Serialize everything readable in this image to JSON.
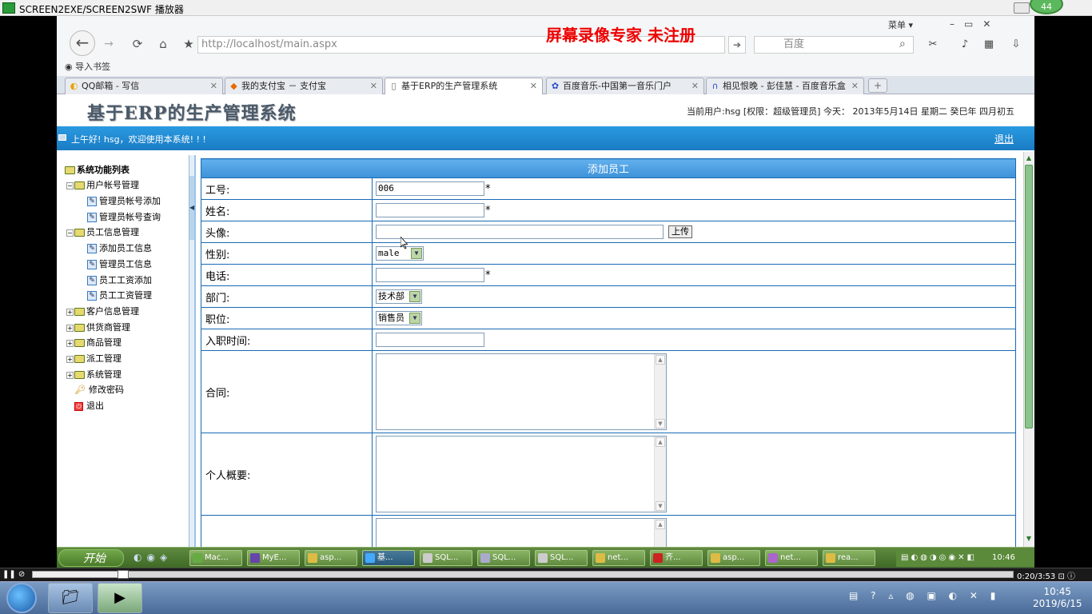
{
  "player": {
    "title": "SCREEN2EXE/SCREEN2SWF 播放器",
    "badge": "44",
    "time": "0:20/3:53"
  },
  "browser": {
    "watermark": "屏幕录像专家  未注册",
    "menu_label": "菜单 ▾",
    "url": "http://localhost/main.aspx",
    "search_placeholder": "百度",
    "bookmarks_label": "导入书签",
    "tabs": [
      {
        "label": "QQ邮箱 - 写信"
      },
      {
        "label": "我的支付宝 － 支付宝"
      },
      {
        "label": "基于ERP的生产管理系统"
      },
      {
        "label": "百度音乐-中国第一音乐门户"
      },
      {
        "label": "相见恨晚 - 彭佳慧 - 百度音乐盒"
      }
    ]
  },
  "page": {
    "title": "基于ERP的生产管理系统",
    "userinfo": "当前用户:hsg [权限：超级管理员] 今天： 2013年5月14日 星期二 癸巳年 四月初五",
    "greeting": "上午好! hsg，欢迎使用本系统! ! !",
    "logout": "退出"
  },
  "sidebar": {
    "root": "系统功能列表",
    "groups": [
      {
        "label": "用户帐号管理",
        "items": [
          "管理员帐号添加",
          "管理员帐号查询"
        ]
      },
      {
        "label": "员工信息管理",
        "items": [
          "添加员工信息",
          "管理员工信息",
          "员工工资添加",
          "员工工资管理"
        ]
      },
      {
        "label": "客户信息管理"
      },
      {
        "label": "供货商管理"
      },
      {
        "label": "商品管理"
      },
      {
        "label": "派工管理"
      },
      {
        "label": "系统管理"
      }
    ],
    "change_password": "修改密码",
    "exit": "退出"
  },
  "form": {
    "heading": "添加员工",
    "employee_id_label": "工号:",
    "employee_id_value": "006",
    "name_label": "姓名:",
    "avatar_label": "头像:",
    "upload_button": "上传",
    "gender_label": "性别:",
    "gender_value": "male",
    "phone_label": "电话:",
    "dept_label": "部门:",
    "dept_value": "技术部",
    "position_label": "职位:",
    "position_value": "销售员",
    "hire_date_label": "入职时间:",
    "contract_label": "合同:",
    "profile_label": "个人概要:",
    "required_mark": "*"
  },
  "recorded_taskbar": {
    "start_label": "开始",
    "buttons": [
      "Mac...",
      "MyE...",
      "asp...",
      "基...",
      "SQL...",
      "SQL...",
      "SQL...",
      "net...",
      "齐...",
      "asp...",
      "net...",
      "rea..."
    ],
    "clock": "10:46"
  },
  "win_taskbar": {
    "time": "10:45",
    "date": "2019/6/15"
  }
}
